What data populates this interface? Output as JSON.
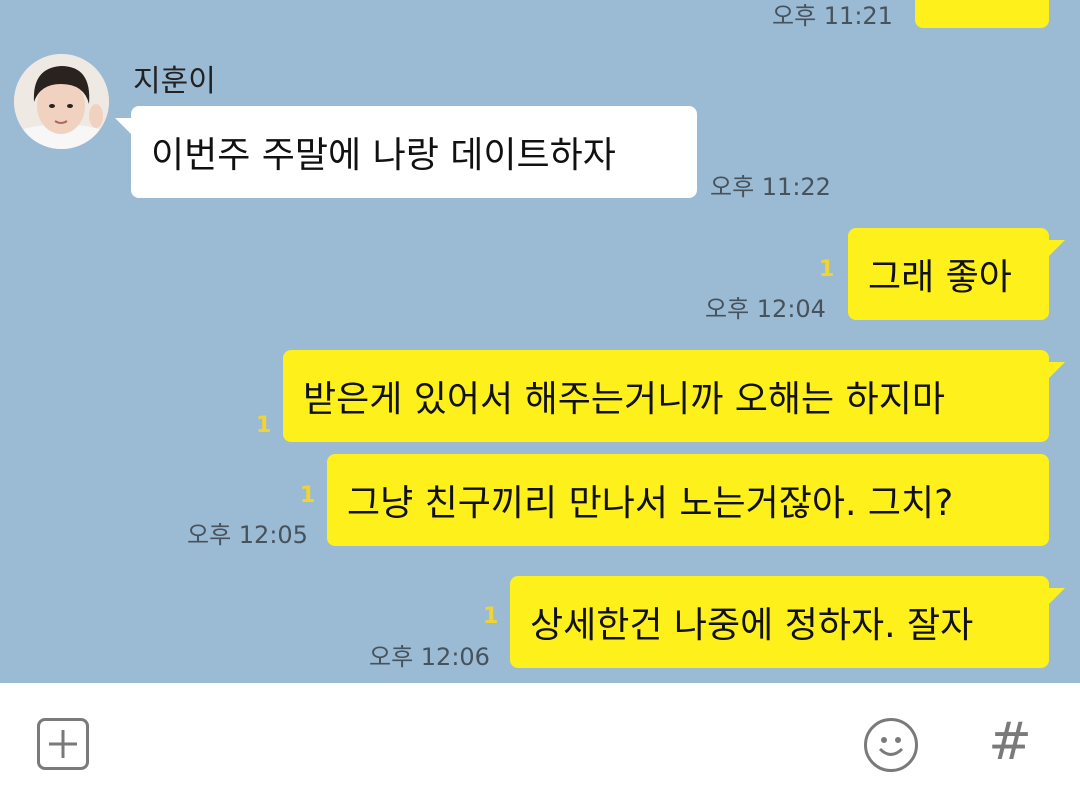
{
  "chat": {
    "contact_name": "지훈이",
    "messages": [
      {
        "id": "m0",
        "sender": "me",
        "text": "",
        "time": "오후 11:21",
        "unread": ""
      },
      {
        "id": "m1",
        "sender": "other",
        "text": "이번주 주말에 나랑 데이트하자",
        "time": "오후 11:22"
      },
      {
        "id": "m2",
        "sender": "me",
        "text": "그래 좋아",
        "time": "오후 12:04",
        "unread": "1"
      },
      {
        "id": "m3",
        "sender": "me",
        "text": "받은게 있어서 해주는거니까 오해는 하지마",
        "time": "",
        "unread": "1"
      },
      {
        "id": "m4",
        "sender": "me",
        "text": "그냥 친구끼리 만나서 노는거잖아. 그치?",
        "time": "오후 12:05",
        "unread": "1"
      },
      {
        "id": "m5",
        "sender": "me",
        "text": "상세한건 나중에 정하자. 잘자",
        "time": "오후 12:06",
        "unread": "1"
      }
    ]
  },
  "input_bar": {
    "icons": [
      "plus-icon",
      "emoji-icon",
      "hash-icon"
    ],
    "hash_symbol": "#"
  },
  "colors": {
    "background": "#9bbbd4",
    "my_bubble": "#fef01b",
    "other_bubble": "#ffffff",
    "unread": "#f2d430"
  }
}
